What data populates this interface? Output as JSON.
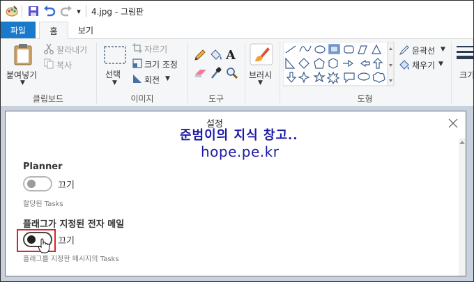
{
  "window": {
    "title": "4.jpg - 그림판",
    "quick_access_dropdown": "▾"
  },
  "tabs": [
    {
      "label": "파일"
    },
    {
      "label": "홈"
    },
    {
      "label": "보기"
    }
  ],
  "ribbon": {
    "clipboard": {
      "paste": "붙여넣기",
      "cut": "잘라내기",
      "copy": "복사",
      "group": "클립보드"
    },
    "image": {
      "select": "선택",
      "crop": "자르기",
      "resize": "크기 조정",
      "rotate": "회전",
      "group": "이미지"
    },
    "tools": {
      "group": "도구"
    },
    "brushes": {
      "label": "브러시"
    },
    "shapes": {
      "outline": "윤곽선",
      "fill": "채우기",
      "group": "도형"
    },
    "size": {
      "label": "크기"
    }
  },
  "dialog": {
    "title": "설정",
    "watermark_line1": "준범이의 지식 창고..",
    "watermark_line2": "hope.pe.kr",
    "sections": [
      {
        "title": "Planner",
        "toggle_label": "끄기",
        "sub": "할당된 Tasks"
      },
      {
        "title": "플래그가 지정된 전자 메일",
        "toggle_label": "끄기",
        "sub": "플래그를 지정한 메시지의 Tasks"
      }
    ]
  },
  "colors": {
    "accent": "#1979ca",
    "highlight": "#e0202a",
    "watermark": "#1a1aa8"
  }
}
